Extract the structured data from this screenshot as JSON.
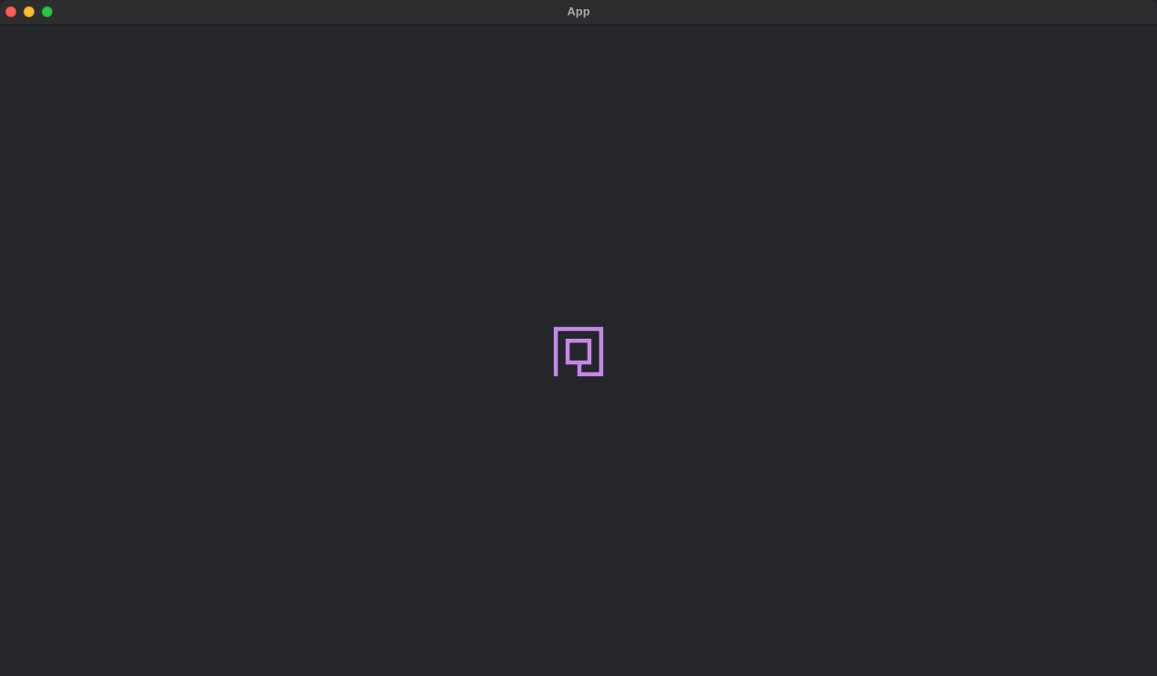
{
  "window": {
    "title": "App",
    "controls": {
      "close": "close-button",
      "minimize": "minimize-button",
      "maximize": "maximize-button"
    }
  },
  "content": {
    "logo": {
      "icon": "app-logo-icon",
      "color": "#c688e8"
    }
  },
  "colors": {
    "background": "#252629",
    "titlebar": "#2d2d2f",
    "close": "#fe5f57",
    "minimize": "#febc2e",
    "maximize": "#28c840"
  }
}
